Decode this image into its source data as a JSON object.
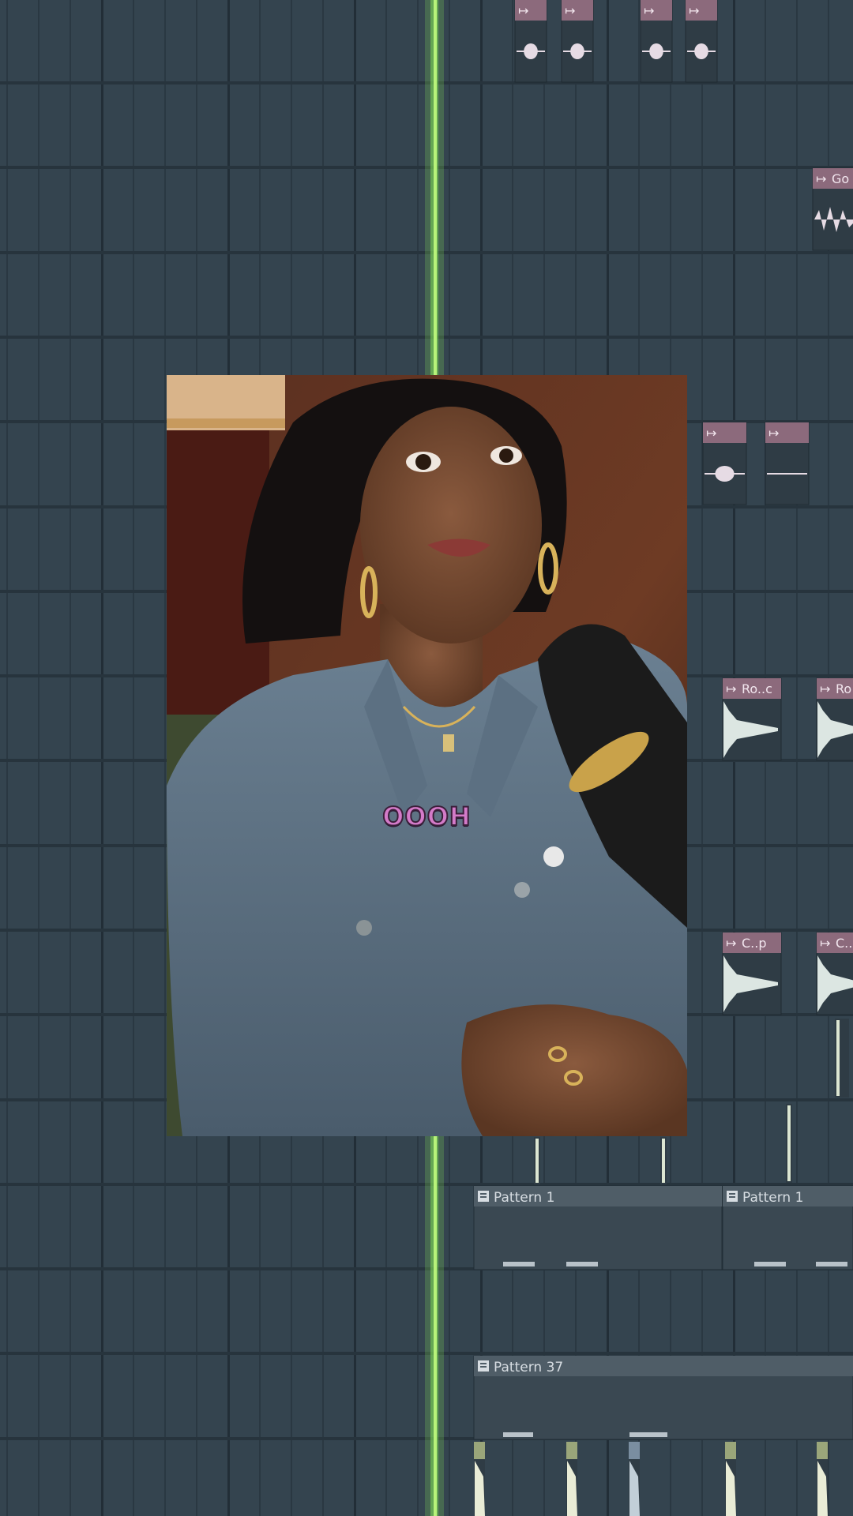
{
  "app": {
    "view": "playlist",
    "playhead_color": "#7ed957",
    "grid_colors": {
      "background": "#34444f",
      "beat_line": "#2a3842",
      "bar_line": "#222e37"
    }
  },
  "audio_clips": [
    {
      "label": "",
      "icon": "clip-arrow-icon"
    },
    {
      "label": "",
      "icon": "clip-arrow-icon"
    },
    {
      "label": "",
      "icon": "clip-arrow-icon"
    },
    {
      "label": "",
      "icon": "clip-arrow-icon"
    },
    {
      "label": "Go",
      "icon": "clip-arrow-icon"
    },
    {
      "label": "",
      "icon": "clip-arrow-icon"
    },
    {
      "label": "",
      "icon": "clip-arrow-icon"
    },
    {
      "label": "Ro..c",
      "icon": "clip-arrow-icon"
    },
    {
      "label": "Ro",
      "icon": "clip-arrow-icon"
    },
    {
      "label": "C..p",
      "icon": "clip-arrow-icon"
    },
    {
      "label": "C..",
      "icon": "clip-arrow-icon"
    }
  ],
  "pattern_clips": [
    {
      "label": "Pattern 1",
      "icon": "pattern-icon"
    },
    {
      "label": "Pattern 1",
      "icon": "pattern-icon"
    },
    {
      "label": "Pattern 37",
      "icon": "pattern-icon"
    }
  ],
  "video": {
    "caption": "OOOH",
    "caption_color": "#d47bc9"
  }
}
